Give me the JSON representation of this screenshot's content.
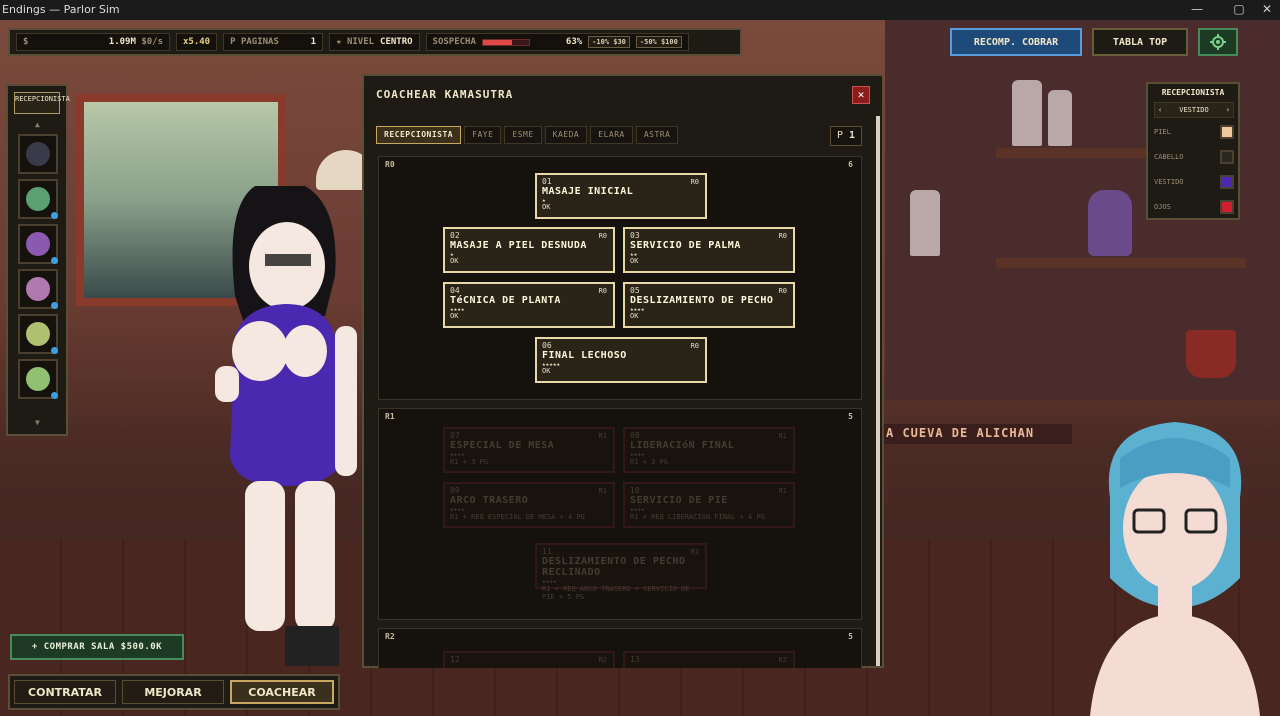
{
  "window": {
    "title": "Endings — Parlor Sim",
    "controls": [
      "—",
      "▢",
      "✕"
    ]
  },
  "topbar": {
    "money_symbol": "$",
    "money": "1.09M",
    "rate": "$0/s",
    "multiplier": "x5.40",
    "pages_label": "PAGINAS",
    "pages_icon": "P",
    "pages": "1",
    "level_icon": "★",
    "level_label": "NIVEL",
    "level_value": "CENTRO",
    "suspicion_label": "SOSPECHA",
    "suspicion_pct": "63%",
    "suspicion_level": 0.63,
    "btn_10": "-10% $30",
    "btn_50": "-50% $100"
  },
  "header_buttons": {
    "recomp": "RECOMP. COBRAR",
    "tabla": "TABLA TOP",
    "settings_icon": "gear-icon"
  },
  "left_panel": {
    "title": "RECEPCIONISTA",
    "up": "▲",
    "down": "▼",
    "avatars": [
      {
        "color": "#3a3a4a",
        "badge": false
      },
      {
        "color": "#5aa070",
        "badge": true
      },
      {
        "color": "#8a5ab0",
        "badge": true
      },
      {
        "color": "#b07ab0",
        "badge": true
      },
      {
        "color": "#b0c070",
        "badge": true
      },
      {
        "color": "#90c070",
        "badge": true
      }
    ]
  },
  "coach": {
    "title": "COACHEAR KAMASUTRA",
    "close": "✕",
    "tabs": [
      "RECEPCIONISTA",
      "FAYE",
      "ESME",
      "KAEDA",
      "ELARA",
      "ASTRA"
    ],
    "active_tab": 0,
    "p_label": "P",
    "p_value": "1",
    "tiers": [
      {
        "label": "R0",
        "count": "6"
      },
      {
        "label": "R1",
        "count": "5"
      },
      {
        "label": "R2",
        "count": "5"
      }
    ],
    "nodes_r0": [
      {
        "num": "01",
        "rank": "R0",
        "name": "MASAJE INICIAL",
        "stars": "★",
        "status": "OK"
      },
      {
        "num": "02",
        "rank": "R0",
        "name": "MASAJE A PIEL DESNUDA",
        "stars": "★",
        "status": "OK"
      },
      {
        "num": "03",
        "rank": "R0",
        "name": "SERVICIO DE PALMA",
        "stars": "★★",
        "status": "OK"
      },
      {
        "num": "04",
        "rank": "R0",
        "name": "TéCNICA DE PLANTA",
        "stars": "★★★★",
        "status": "OK"
      },
      {
        "num": "05",
        "rank": "R0",
        "name": "DESLIZAMIENTO DE PECHO",
        "stars": "★★★★",
        "status": "OK"
      },
      {
        "num": "06",
        "rank": "R0",
        "name": "FINAL LECHOSO",
        "stars": "★★★★★",
        "status": "OK"
      }
    ],
    "nodes_r1": [
      {
        "num": "07",
        "rank": "R1",
        "name": "ESPECIAL DE MESA",
        "stars": "★★★★",
        "req": "R1 + 3 PG"
      },
      {
        "num": "08",
        "rank": "R1",
        "name": "LIBERACIóN FINAL",
        "stars": "★★★★",
        "req": "R1 + 3 PG"
      },
      {
        "num": "09",
        "rank": "R1",
        "name": "ARCO TRASERO",
        "stars": "★★★★",
        "req": "R1 + REQ ESPECIAL DE MESA + 4 PG"
      },
      {
        "num": "10",
        "rank": "R1",
        "name": "SERVICIO DE PIE",
        "stars": "★★★★",
        "req": "R1 + REQ LIBERACIóN FINAL + 4 PG"
      },
      {
        "num": "11",
        "rank": "R1",
        "name": "DESLIZAMIENTO DE PECHO RECLINADO",
        "stars": "★★★★",
        "req": "R1 + REQ ARCO TRASERO + SERVICIO DE PIE + 5 PG"
      }
    ],
    "nodes_r2": [
      {
        "num": "12",
        "rank": "R2"
      },
      {
        "num": "13",
        "rank": "R2"
      }
    ]
  },
  "custom_panel": {
    "title": "RECEPCIONISTA",
    "prev": "‹",
    "next": "›",
    "selected": "VESTIDO",
    "rows": [
      {
        "label": "PIEL",
        "color": "#f0c8a0"
      },
      {
        "label": "CABELLO",
        "color": "#2a2620"
      },
      {
        "label": "VESTIDO",
        "color": "#4a28b0"
      },
      {
        "label": "OJOS",
        "color": "#d02030"
      }
    ]
  },
  "buy_button": "+ COMPRAR SALA $500.0K",
  "nav": {
    "items": [
      "CONTRATAR",
      "MEJORAR",
      "COACHEAR"
    ],
    "active": 2
  },
  "sign": "A CUEVA DE ALICHAN"
}
